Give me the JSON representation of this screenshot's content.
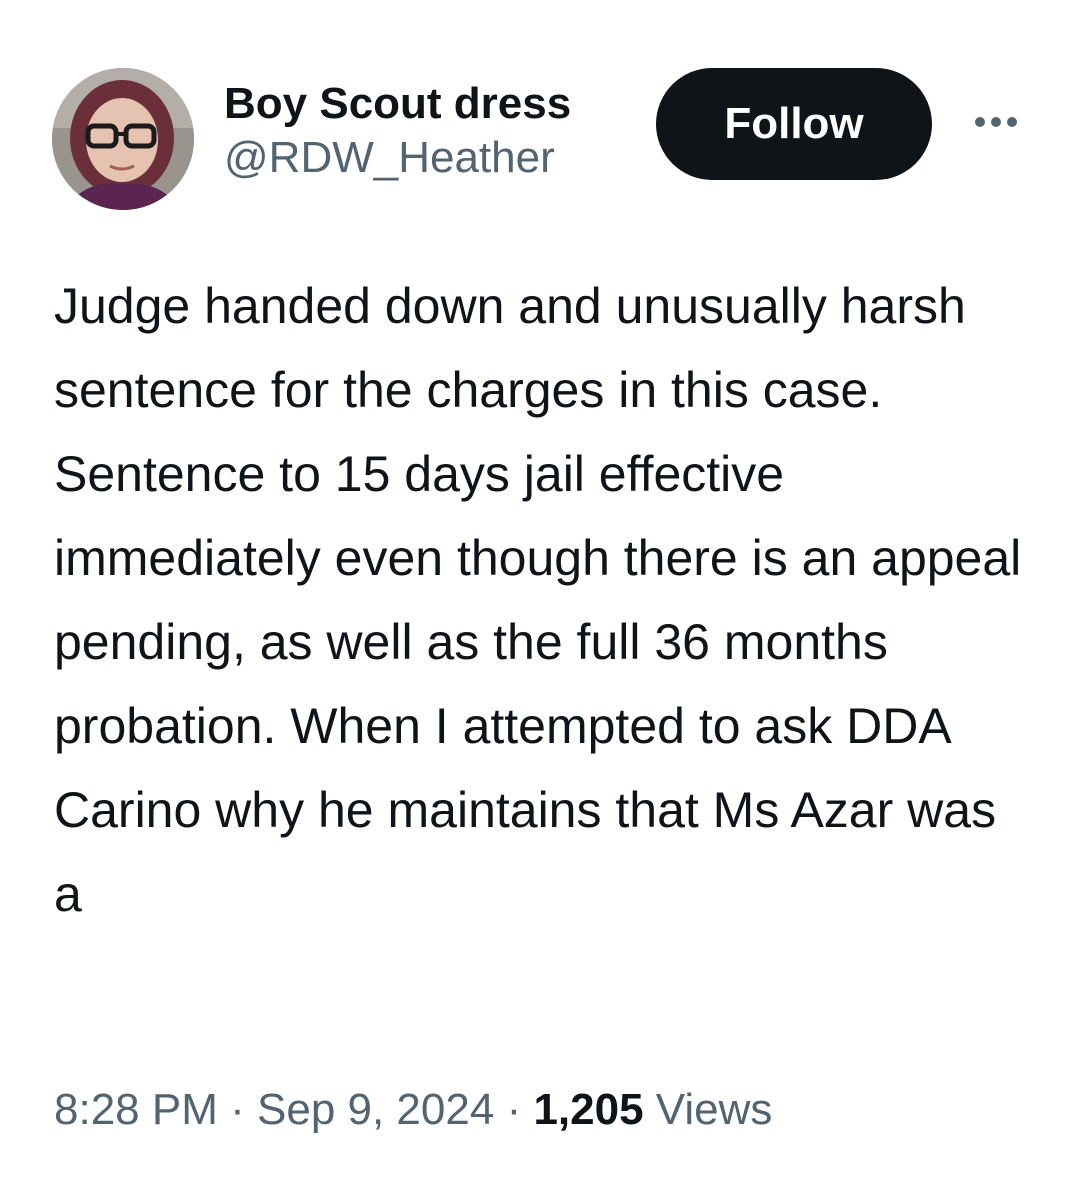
{
  "author": {
    "display_name": "Boy Scout dress",
    "handle": "@RDW_Heather",
    "avatar_icon": "profile-photo"
  },
  "actions": {
    "follow_label": "Follow",
    "more_icon": "ellipsis-icon"
  },
  "tweet": {
    "text": "Judge handed down and unusually harsh sentence for the charges in this case. Sentence to 15 days jail effective immediately even though there is an appeal pending, as well as the full 36 months probation. When I attempted to ask DDA Carino why he maintains that Ms Azar was a"
  },
  "meta": {
    "time": "8:28 PM",
    "separator": "·",
    "date": "Sep 9, 2024",
    "views_count": "1,205",
    "views_label": "Views"
  },
  "colors": {
    "text_primary": "#0f1419",
    "text_secondary": "#536471",
    "follow_button_bg": "#0f1419",
    "follow_button_text": "#ffffff",
    "background": "#ffffff"
  }
}
